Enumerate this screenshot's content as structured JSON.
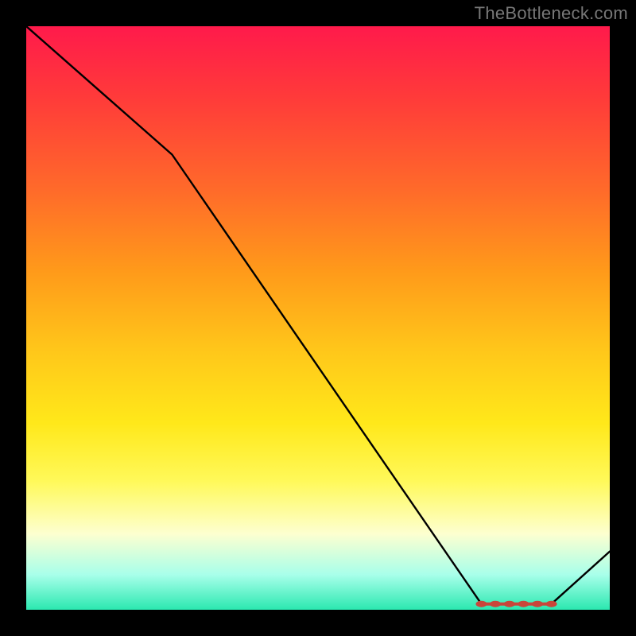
{
  "watermark": "TheBottleneck.com",
  "colors": {
    "frame": "#000000",
    "gradient_top": "#ff1a4b",
    "gradient_bottom": "#2be8b0",
    "curve": "#000000",
    "markers": "#c9453a"
  },
  "chart_data": {
    "type": "line",
    "title": "",
    "xlabel": "",
    "ylabel": "",
    "xlim": [
      0,
      100
    ],
    "ylim": [
      0,
      100
    ],
    "x": [
      0,
      25,
      78,
      90,
      100
    ],
    "values": [
      100,
      78,
      1,
      1,
      10
    ],
    "marker_region": {
      "x_start": 78,
      "x_end": 90,
      "y": 1
    },
    "annotations": []
  }
}
